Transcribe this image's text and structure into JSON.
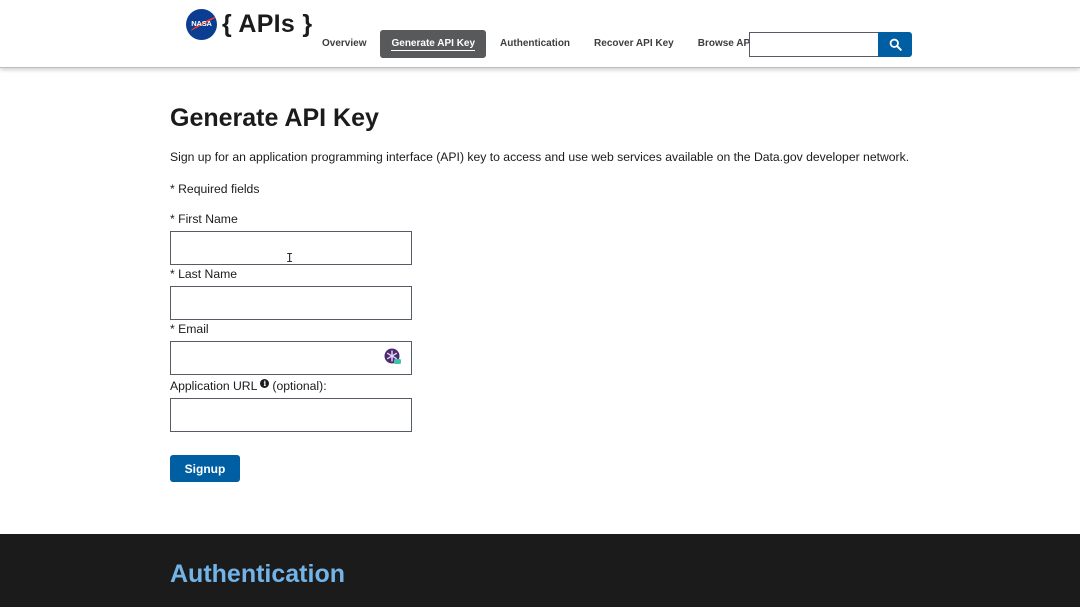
{
  "header": {
    "logo_text": "{ APIs }",
    "logo_badge": "NASA",
    "nav": [
      {
        "label": "Overview"
      },
      {
        "label": "Generate API Key"
      },
      {
        "label": "Authentication"
      },
      {
        "label": "Recover API Key"
      },
      {
        "label": "Browse APIs"
      }
    ],
    "search_placeholder": "",
    "search_icon": "search-icon"
  },
  "main": {
    "title": "Generate API Key",
    "intro": "Sign up for an application programming interface (API) key to access and use web services available on the Data.gov developer network.",
    "required_note": "* Required fields",
    "fields": {
      "first_name": {
        "label": "* First Name",
        "value": ""
      },
      "last_name": {
        "label": "* Last Name",
        "value": ""
      },
      "email": {
        "label": "* Email",
        "value": ""
      },
      "app_url": {
        "label_prefix": "Application URL",
        "label_suffix": "(optional):",
        "value": ""
      }
    },
    "signup_label": "Signup"
  },
  "auth_section": {
    "heading": "Authentication"
  },
  "colors": {
    "accent": "#005ea2",
    "nav_active": "#58595b",
    "dark_bg": "#1b1b1b",
    "auth_heading": "#73b3e7"
  }
}
